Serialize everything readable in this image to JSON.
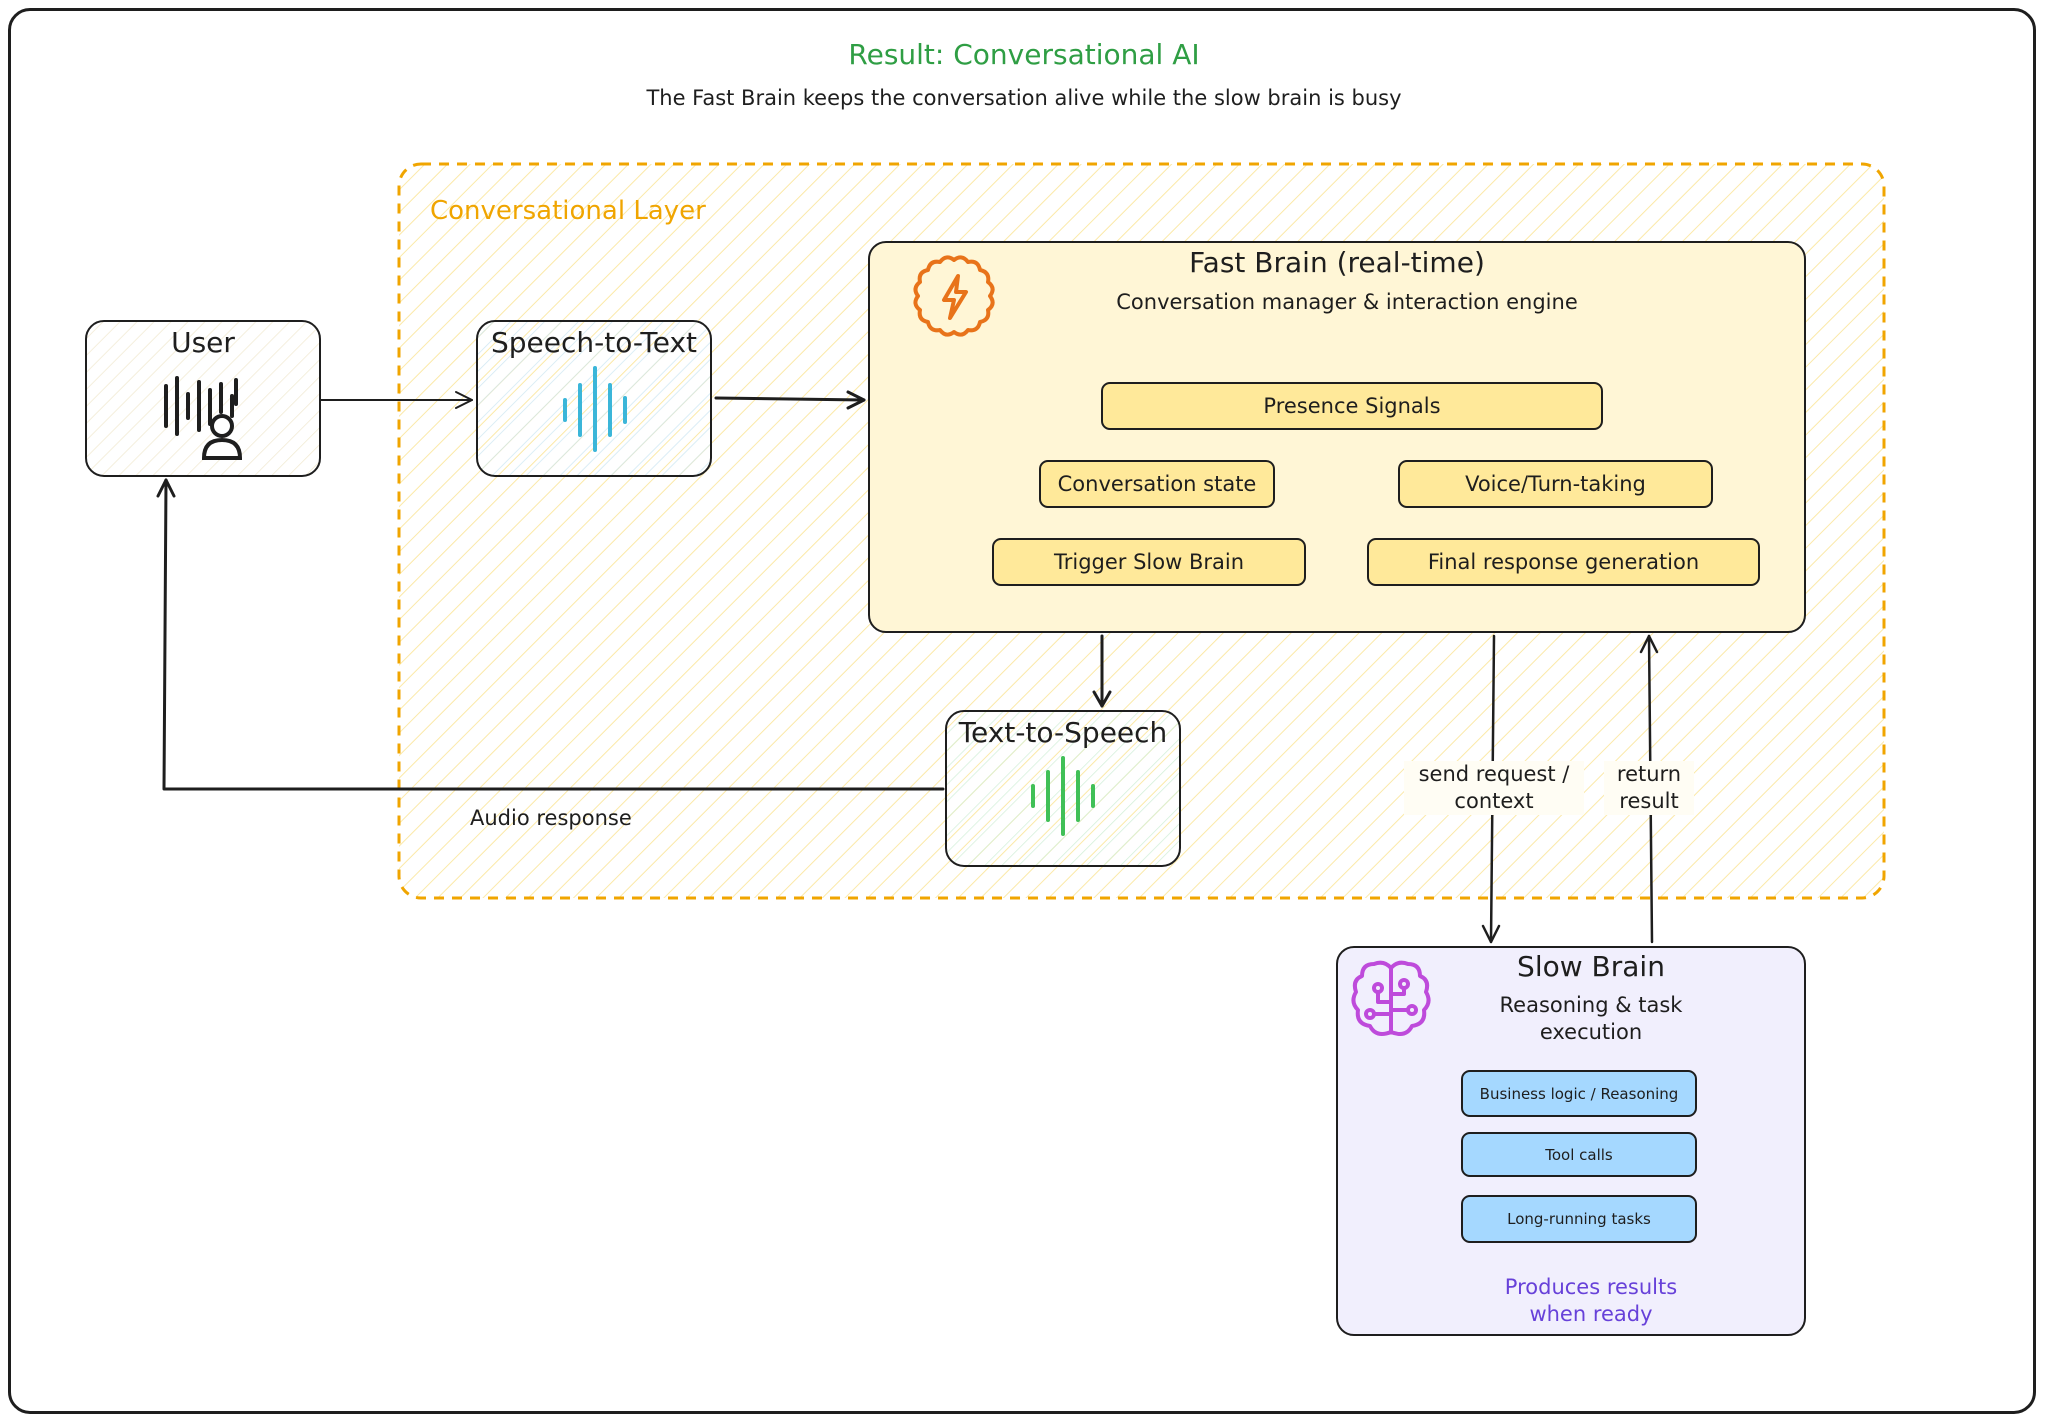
{
  "header": {
    "title": "Result: Conversational AI",
    "subtitle": "The Fast Brain keeps the conversation alive while the slow brain is busy"
  },
  "layer": {
    "label": "Conversational Layer"
  },
  "nodes": {
    "user": {
      "label": "User"
    },
    "stt": {
      "label": "Speech-to-Text"
    },
    "tts": {
      "label": "Text-to-Speech"
    },
    "fast_brain": {
      "title": "Fast Brain (real-time)",
      "subtitle": "Conversation manager & interaction engine",
      "chips": [
        "Presence Signals",
        "Conversation state",
        "Voice/Turn-taking",
        "Trigger Slow Brain",
        "Final response generation"
      ]
    },
    "slow_brain": {
      "title": "Slow Brain",
      "subtitle_line1": "Reasoning & task",
      "subtitle_line2": "execution",
      "chips": [
        "Business logic / Reasoning",
        "Tool calls",
        "Long-running tasks"
      ],
      "note_line1": "Produces results",
      "note_line2": "when ready"
    }
  },
  "edges": {
    "audio_response": "Audio response",
    "send_request_line1": "send request /",
    "send_request_line2": "context",
    "return_result_line1": "return",
    "return_result_line2": "result"
  },
  "colors": {
    "title": "#2f9e44",
    "layer": "#f0a500",
    "fast_fill": "#fff6d6",
    "fast_chip": "#ffe99a",
    "slow_fill": "#f1effd",
    "slow_chip": "#a5d8ff",
    "slow_note": "#6741d9",
    "stt_wave": "#3bb6d9",
    "tts_wave": "#40c057",
    "fast_icon": "#e8731a",
    "slow_icon": "#be4bdb"
  }
}
